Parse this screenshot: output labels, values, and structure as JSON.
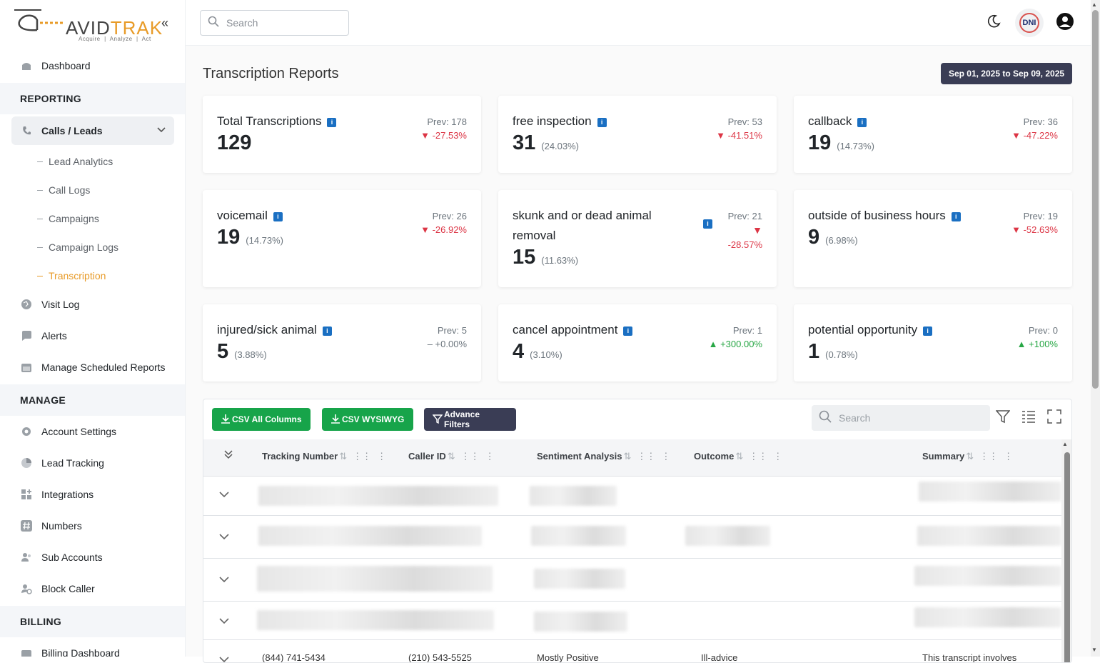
{
  "app": {
    "logo_main": "AVID",
    "logo_accent": "TRAK",
    "logo_tagline": "Acquire  |  Analyze  |  Act",
    "collapse_icon": "«"
  },
  "sidebar": {
    "dashboard": "Dashboard",
    "reporting_section": "REPORTING",
    "calls_leads": "Calls / Leads",
    "sub_items": [
      "Lead Analytics",
      "Call Logs",
      "Campaigns",
      "Campaign Logs",
      "Transcription"
    ],
    "visit_log": "Visit Log",
    "alerts": "Alerts",
    "manage_scheduled_reports": "Manage Scheduled Reports",
    "manage_section": "MANAGE",
    "account_settings": "Account Settings",
    "lead_tracking": "Lead Tracking",
    "integrations": "Integrations",
    "numbers": "Numbers",
    "sub_accounts": "Sub Accounts",
    "block_caller": "Block Caller",
    "billing_section": "BILLING",
    "billing_dashboard": "Billing Dashboard"
  },
  "topbar": {
    "search_placeholder": "Search",
    "dni_label": "DNI"
  },
  "page": {
    "title": "Transcription Reports",
    "date_range": "Sep 01, 2025 to Sep 09, 2025"
  },
  "cards": [
    {
      "title": "Total Transcriptions",
      "value": "129",
      "pct": "",
      "prev": "Prev: 178",
      "change": "▼ -27.53%",
      "trend": "down"
    },
    {
      "title": "free inspection",
      "value": "31",
      "pct": "(24.03%)",
      "prev": "Prev: 53",
      "change": "▼ -41.51%",
      "trend": "down"
    },
    {
      "title": "callback",
      "value": "19",
      "pct": "(14.73%)",
      "prev": "Prev: 36",
      "change": "▼ -47.22%",
      "trend": "down"
    },
    {
      "title": "voicemail",
      "value": "19",
      "pct": "(14.73%)",
      "prev": "Prev: 26",
      "change": "▼ -26.92%",
      "trend": "down"
    },
    {
      "title": "skunk and or dead animal removal",
      "value": "15",
      "pct": "(11.63%)",
      "prev": "Prev: 21",
      "change": "-28.57%",
      "trend": "down"
    },
    {
      "title": "outside of business hours",
      "value": "9",
      "pct": "(6.98%)",
      "prev": "Prev: 19",
      "change": "▼ -52.63%",
      "trend": "down"
    },
    {
      "title": "injured/sick animal",
      "value": "5",
      "pct": "(3.88%)",
      "prev": "Prev: 5",
      "change": "– +0.00%",
      "trend": "flat"
    },
    {
      "title": "cancel appointment",
      "value": "4",
      "pct": "(3.10%)",
      "prev": "Prev: 1",
      "change": "▲ +300.00%",
      "trend": "up"
    },
    {
      "title": "potential opportunity",
      "value": "1",
      "pct": "(0.78%)",
      "prev": "Prev: 0",
      "change": "▲ +100%",
      "trend": "up"
    }
  ],
  "table": {
    "buttons": {
      "csv_all": "CSV All Columns",
      "csv_wysiwyg": "CSV WYSIWYG",
      "advance_filters": "Advance Filters"
    },
    "search_placeholder": "Search",
    "columns": [
      "Tracking Number",
      "Caller ID",
      "Sentiment Analysis",
      "Outcome",
      "Summary"
    ],
    "last_row": {
      "tracking_number": "(844) 741-5434",
      "caller_id": "(210) 543-5525",
      "sentiment": "Mostly Positive",
      "outcome": "Ill-advice",
      "summary": "This transcript involves"
    }
  },
  "colors": {
    "accent": "#e89b28",
    "green_button": "#17a44a",
    "dark_button": "#3a3d55",
    "down": "#dc3545",
    "up": "#28a745"
  }
}
